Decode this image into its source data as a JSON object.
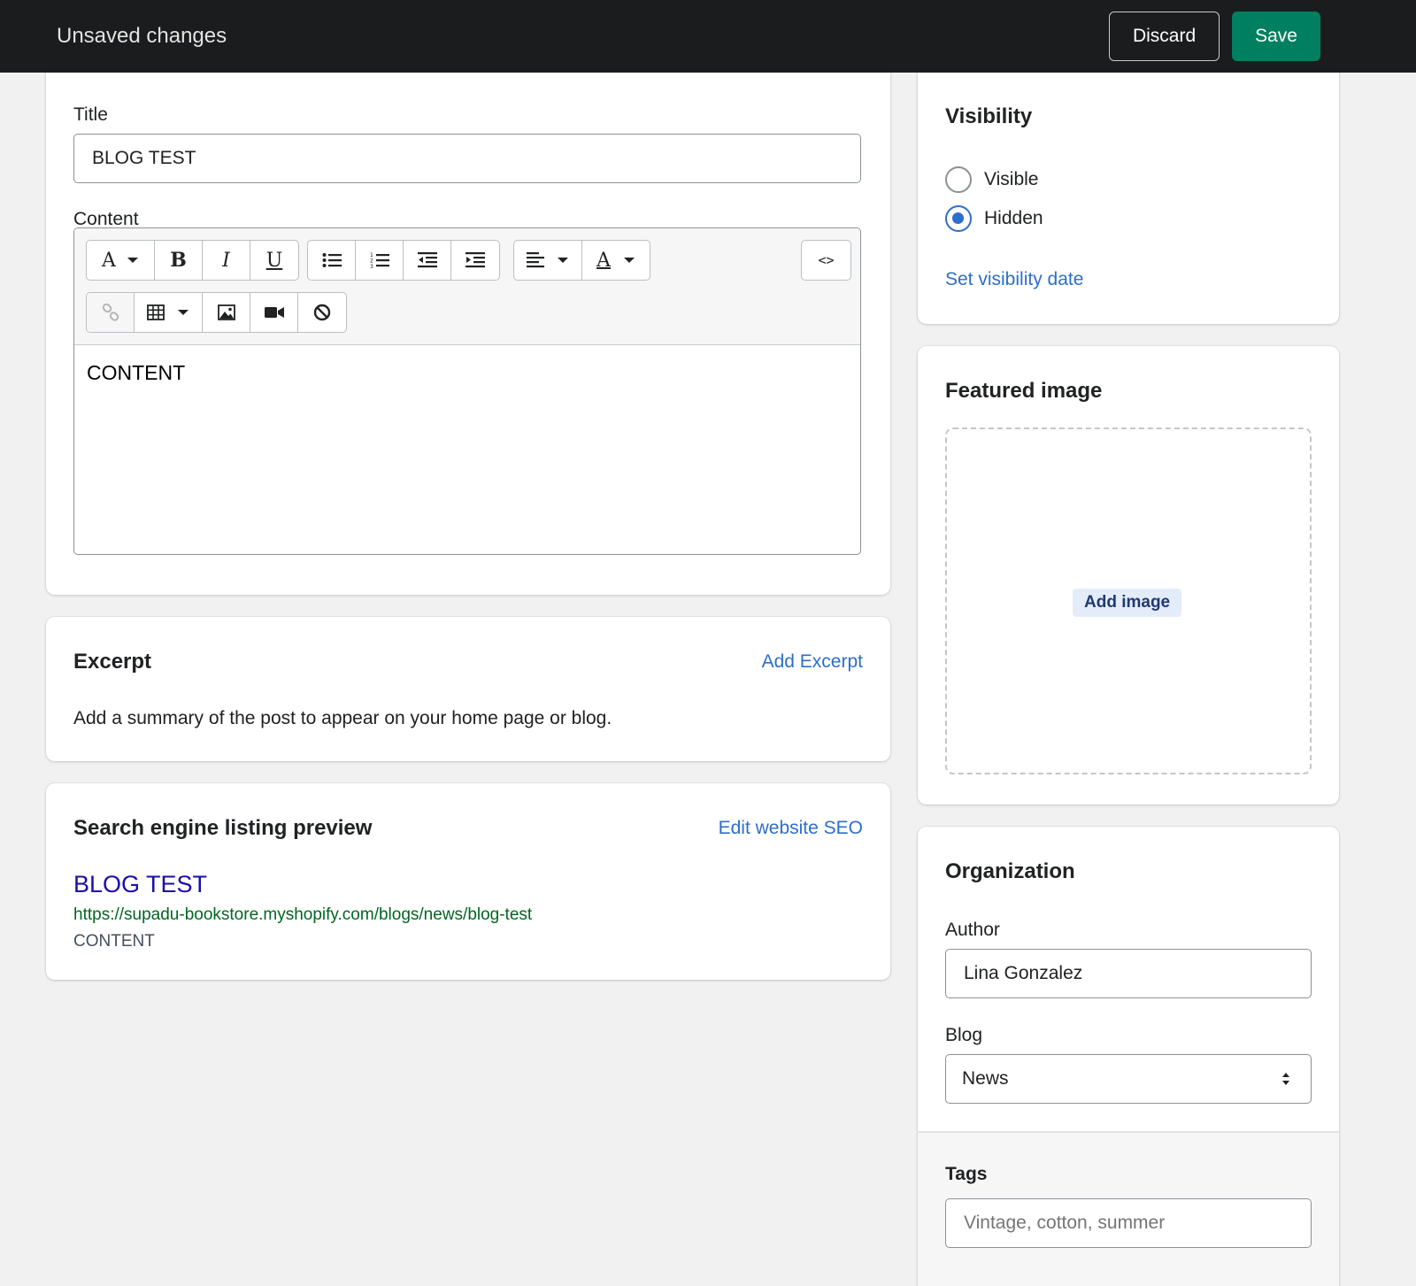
{
  "topbar": {
    "title": "Unsaved changes",
    "discard_label": "Discard",
    "save_label": "Save"
  },
  "main_card": {
    "title_label": "Title",
    "title_value": "BLOG TEST",
    "content_label": "Content",
    "content_value": "CONTENT",
    "toolbar": {
      "font_glyph": "A",
      "bold_glyph": "B",
      "italic_glyph": "I",
      "underline_glyph": "U",
      "text_color_glyph": "A",
      "html_glyph": "<>"
    }
  },
  "excerpt": {
    "heading": "Excerpt",
    "action_label": "Add Excerpt",
    "description": "Add a summary of the post to appear on your home page or blog."
  },
  "seo": {
    "heading": "Search engine listing preview",
    "action_label": "Edit website SEO",
    "preview_title": "BLOG TEST",
    "preview_url": "https://supadu-bookstore.myshopify.com/blogs/news/blog-test",
    "preview_description": "CONTENT"
  },
  "visibility": {
    "heading": "Visibility",
    "options": [
      {
        "label": "Visible",
        "checked": false
      },
      {
        "label": "Hidden",
        "checked": true
      }
    ],
    "date_link": "Set visibility date"
  },
  "featured_image": {
    "heading": "Featured image",
    "add_label": "Add image"
  },
  "organization": {
    "heading": "Organization",
    "author_label": "Author",
    "author_value": "Lina Gonzalez",
    "blog_label": "Blog",
    "blog_value": "News",
    "tags_label": "Tags",
    "tags_placeholder": "Vintage, cotton, summer"
  },
  "colors": {
    "topbar_bg": "#1a1c1d",
    "save_green": "#008060",
    "link_blue": "#2c6ecb",
    "seo_title": "#1a0dab",
    "seo_url": "#006621"
  }
}
